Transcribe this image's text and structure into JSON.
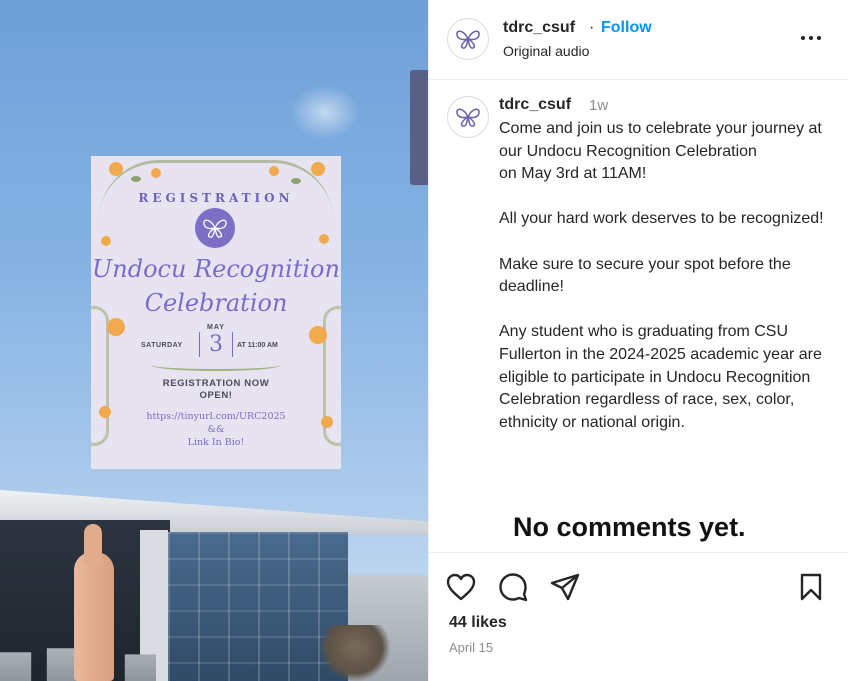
{
  "post": {
    "username": "tdrc_csuf",
    "separator": "·",
    "follow_label": "Follow",
    "audio_label": "Original audio",
    "caption_time": "1w",
    "caption": "Come and join us to celebrate your journey at our Undocu Recognition Celebration\non May 3rd at 11AM!\n\nAll your hard work deserves to be recognized!\n\nMake sure to secure your spot before the deadline!\n\nAny student who is graduating from CSU Fullerton in the 2024-2025 academic year are eligible to participate in Undocu Recognition Celebration regardless of race, sex, color, ethnicity or national origin.",
    "no_comments": "No comments yet.",
    "likes": "44 likes",
    "date": "April 15"
  },
  "poster": {
    "heading": "REGISTRATION",
    "title_line1": "Undocu Recognition",
    "title_line2": "Celebration",
    "month": "MAY",
    "weekday": "SATURDAY",
    "day": "3",
    "time": "AT 11:00 AM",
    "reg_line1": "REGISTRATION NOW",
    "reg_line2": "OPEN!",
    "url": "https://tinyurl.com/URC2025",
    "amp": "&&",
    "link": "Link In Bio!"
  },
  "icons": {
    "like": "heart-icon",
    "comment": "comment-icon",
    "share": "share-icon",
    "save": "bookmark-icon",
    "more": "more-options-icon",
    "avatar": "butterfly-icon"
  },
  "colors": {
    "follow": "#0095f6",
    "poster_purple": "#7a6cc7",
    "poster_bg": "#e7e3f1",
    "sky": "#86b3e3"
  }
}
